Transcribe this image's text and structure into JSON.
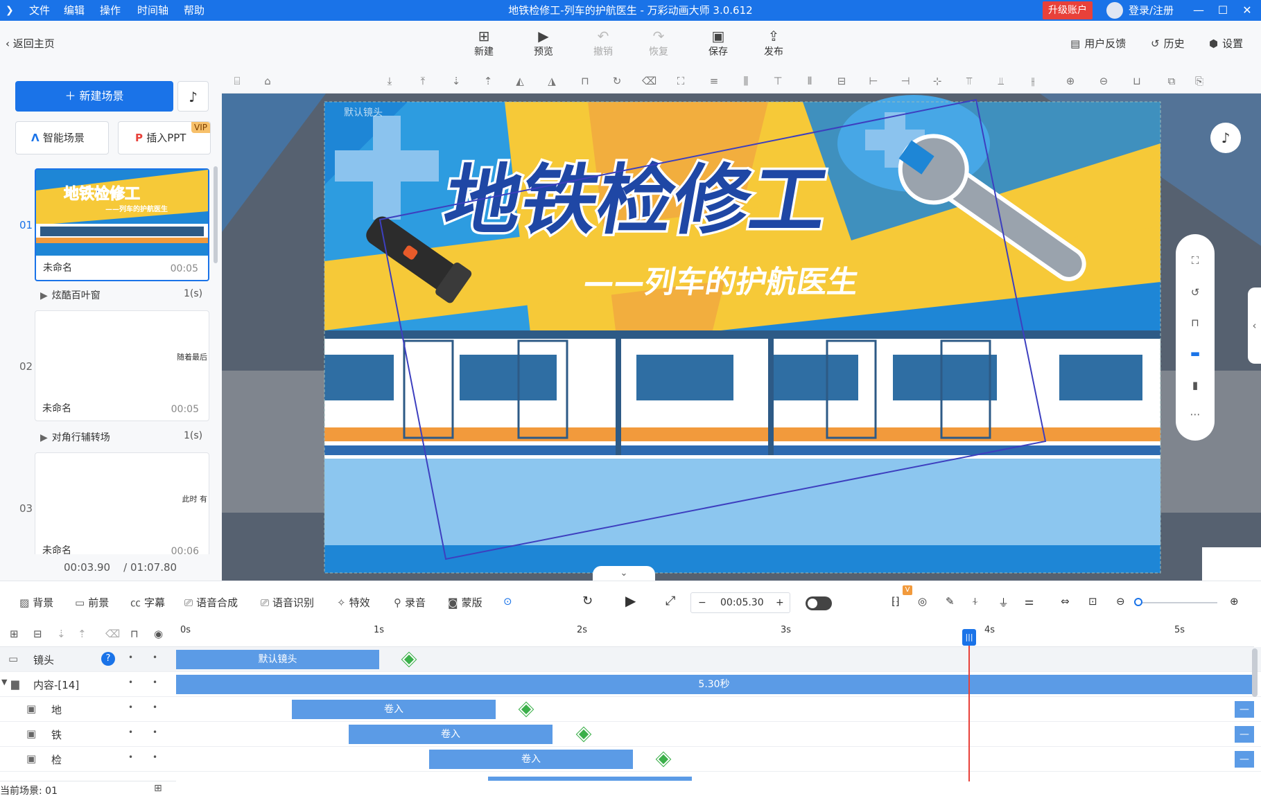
{
  "app": {
    "window_title": "地铁检修工-列车的护航医生 - 万彩动画大师 3.0.612",
    "menu": [
      "文件",
      "编辑",
      "操作",
      "时间轴",
      "帮助"
    ],
    "upgrade_label": "升级账户",
    "login_label": "登录/注册"
  },
  "toolbar": {
    "back_label": "返回主页",
    "buttons": [
      {
        "label": "新建",
        "icon": "plus-square-icon",
        "enabled": true
      },
      {
        "label": "预览",
        "icon": "play-icon",
        "enabled": true
      },
      {
        "label": "撤销",
        "icon": "undo-icon",
        "enabled": false
      },
      {
        "label": "恢复",
        "icon": "redo-icon",
        "enabled": false
      },
      {
        "label": "保存",
        "icon": "save-icon",
        "enabled": true
      },
      {
        "label": "发布",
        "icon": "publish-icon",
        "enabled": true
      }
    ],
    "right": [
      {
        "label": "用户反馈",
        "icon": "feedback-icon"
      },
      {
        "label": "历史",
        "icon": "history-icon"
      },
      {
        "label": "设置",
        "icon": "gear-icon"
      }
    ]
  },
  "left_panel": {
    "new_scene_label": "新建场景",
    "smart_scene_label": "智能场景",
    "insert_ppt_label": "插入PPT",
    "vip_badge": "VIP",
    "scenes": [
      {
        "num": "01",
        "name": "未命名",
        "duration": "00:05",
        "text": "",
        "thumb_title": "地铁检修工",
        "thumb_subtitle": "——列车的护航医生"
      },
      {
        "num": "02",
        "name": "未命名",
        "duration": "00:05",
        "text": "随着最后"
      },
      {
        "num": "03",
        "name": "未命名",
        "duration": "00:06",
        "text": "此时 有"
      }
    ],
    "transitions": [
      {
        "label": "炫酷百叶窗",
        "duration": "1(s)"
      },
      {
        "label": "对角行辅转场",
        "duration": "1(s)"
      }
    ],
    "current_time": "00:03.90",
    "total_time": "/ 01:07.80"
  },
  "canvas": {
    "camera_label": "默认镜头",
    "title": "地铁检修工",
    "subtitle": "——列车的护航医生",
    "colors": {
      "blue": "#1e86d6",
      "yellow": "#f6c938",
      "navy": "#1f47a5",
      "orange": "#f29a3c"
    }
  },
  "bottom_toolbar": {
    "tools": [
      {
        "label": "背景",
        "icon": "background-icon"
      },
      {
        "label": "前景",
        "icon": "foreground-icon"
      },
      {
        "label": "字幕",
        "icon": "subtitle-icon"
      },
      {
        "label": "语音合成",
        "icon": "tts-icon"
      },
      {
        "label": "语音识别",
        "icon": "asr-icon"
      },
      {
        "label": "特效",
        "icon": "effects-icon"
      },
      {
        "label": "录音",
        "icon": "mic-icon"
      },
      {
        "label": "蒙版",
        "icon": "mask-icon"
      }
    ],
    "time_value": "00:05.30",
    "v_badge": "V"
  },
  "timeline": {
    "ticks": [
      "0s",
      "1s",
      "2s",
      "3s",
      "4s",
      "5s"
    ],
    "rows": [
      {
        "label": "镜头",
        "clip": "默认镜头"
      },
      {
        "label": "内容-[14]",
        "clip": "5.30秒"
      },
      {
        "label": "地",
        "clip": "卷入"
      },
      {
        "label": "铁",
        "clip": "卷入"
      },
      {
        "label": "检",
        "clip": "卷入"
      }
    ],
    "current_scene": "当前场景: 01"
  }
}
